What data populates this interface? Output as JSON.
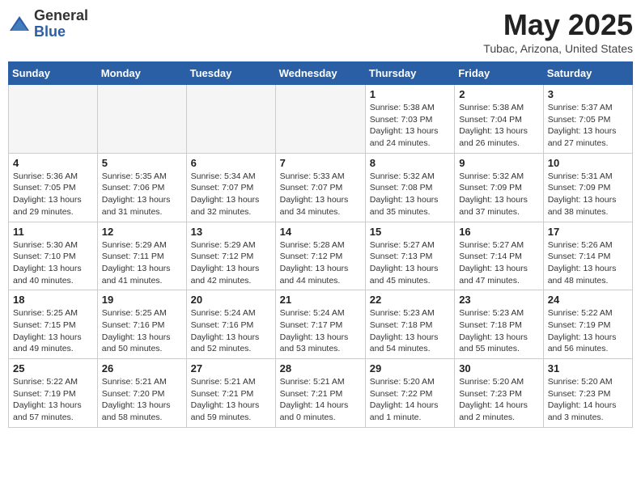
{
  "header": {
    "logo_general": "General",
    "logo_blue": "Blue",
    "title": "May 2025",
    "subtitle": "Tubac, Arizona, United States"
  },
  "days_of_week": [
    "Sunday",
    "Monday",
    "Tuesday",
    "Wednesday",
    "Thursday",
    "Friday",
    "Saturday"
  ],
  "weeks": [
    [
      {
        "day": "",
        "info": ""
      },
      {
        "day": "",
        "info": ""
      },
      {
        "day": "",
        "info": ""
      },
      {
        "day": "",
        "info": ""
      },
      {
        "day": "1",
        "info": "Sunrise: 5:38 AM\nSunset: 7:03 PM\nDaylight: 13 hours\nand 24 minutes."
      },
      {
        "day": "2",
        "info": "Sunrise: 5:38 AM\nSunset: 7:04 PM\nDaylight: 13 hours\nand 26 minutes."
      },
      {
        "day": "3",
        "info": "Sunrise: 5:37 AM\nSunset: 7:05 PM\nDaylight: 13 hours\nand 27 minutes."
      }
    ],
    [
      {
        "day": "4",
        "info": "Sunrise: 5:36 AM\nSunset: 7:05 PM\nDaylight: 13 hours\nand 29 minutes."
      },
      {
        "day": "5",
        "info": "Sunrise: 5:35 AM\nSunset: 7:06 PM\nDaylight: 13 hours\nand 31 minutes."
      },
      {
        "day": "6",
        "info": "Sunrise: 5:34 AM\nSunset: 7:07 PM\nDaylight: 13 hours\nand 32 minutes."
      },
      {
        "day": "7",
        "info": "Sunrise: 5:33 AM\nSunset: 7:07 PM\nDaylight: 13 hours\nand 34 minutes."
      },
      {
        "day": "8",
        "info": "Sunrise: 5:32 AM\nSunset: 7:08 PM\nDaylight: 13 hours\nand 35 minutes."
      },
      {
        "day": "9",
        "info": "Sunrise: 5:32 AM\nSunset: 7:09 PM\nDaylight: 13 hours\nand 37 minutes."
      },
      {
        "day": "10",
        "info": "Sunrise: 5:31 AM\nSunset: 7:09 PM\nDaylight: 13 hours\nand 38 minutes."
      }
    ],
    [
      {
        "day": "11",
        "info": "Sunrise: 5:30 AM\nSunset: 7:10 PM\nDaylight: 13 hours\nand 40 minutes."
      },
      {
        "day": "12",
        "info": "Sunrise: 5:29 AM\nSunset: 7:11 PM\nDaylight: 13 hours\nand 41 minutes."
      },
      {
        "day": "13",
        "info": "Sunrise: 5:29 AM\nSunset: 7:12 PM\nDaylight: 13 hours\nand 42 minutes."
      },
      {
        "day": "14",
        "info": "Sunrise: 5:28 AM\nSunset: 7:12 PM\nDaylight: 13 hours\nand 44 minutes."
      },
      {
        "day": "15",
        "info": "Sunrise: 5:27 AM\nSunset: 7:13 PM\nDaylight: 13 hours\nand 45 minutes."
      },
      {
        "day": "16",
        "info": "Sunrise: 5:27 AM\nSunset: 7:14 PM\nDaylight: 13 hours\nand 47 minutes."
      },
      {
        "day": "17",
        "info": "Sunrise: 5:26 AM\nSunset: 7:14 PM\nDaylight: 13 hours\nand 48 minutes."
      }
    ],
    [
      {
        "day": "18",
        "info": "Sunrise: 5:25 AM\nSunset: 7:15 PM\nDaylight: 13 hours\nand 49 minutes."
      },
      {
        "day": "19",
        "info": "Sunrise: 5:25 AM\nSunset: 7:16 PM\nDaylight: 13 hours\nand 50 minutes."
      },
      {
        "day": "20",
        "info": "Sunrise: 5:24 AM\nSunset: 7:16 PM\nDaylight: 13 hours\nand 52 minutes."
      },
      {
        "day": "21",
        "info": "Sunrise: 5:24 AM\nSunset: 7:17 PM\nDaylight: 13 hours\nand 53 minutes."
      },
      {
        "day": "22",
        "info": "Sunrise: 5:23 AM\nSunset: 7:18 PM\nDaylight: 13 hours\nand 54 minutes."
      },
      {
        "day": "23",
        "info": "Sunrise: 5:23 AM\nSunset: 7:18 PM\nDaylight: 13 hours\nand 55 minutes."
      },
      {
        "day": "24",
        "info": "Sunrise: 5:22 AM\nSunset: 7:19 PM\nDaylight: 13 hours\nand 56 minutes."
      }
    ],
    [
      {
        "day": "25",
        "info": "Sunrise: 5:22 AM\nSunset: 7:19 PM\nDaylight: 13 hours\nand 57 minutes."
      },
      {
        "day": "26",
        "info": "Sunrise: 5:21 AM\nSunset: 7:20 PM\nDaylight: 13 hours\nand 58 minutes."
      },
      {
        "day": "27",
        "info": "Sunrise: 5:21 AM\nSunset: 7:21 PM\nDaylight: 13 hours\nand 59 minutes."
      },
      {
        "day": "28",
        "info": "Sunrise: 5:21 AM\nSunset: 7:21 PM\nDaylight: 14 hours\nand 0 minutes."
      },
      {
        "day": "29",
        "info": "Sunrise: 5:20 AM\nSunset: 7:22 PM\nDaylight: 14 hours\nand 1 minute."
      },
      {
        "day": "30",
        "info": "Sunrise: 5:20 AM\nSunset: 7:23 PM\nDaylight: 14 hours\nand 2 minutes."
      },
      {
        "day": "31",
        "info": "Sunrise: 5:20 AM\nSunset: 7:23 PM\nDaylight: 14 hours\nand 3 minutes."
      }
    ]
  ]
}
